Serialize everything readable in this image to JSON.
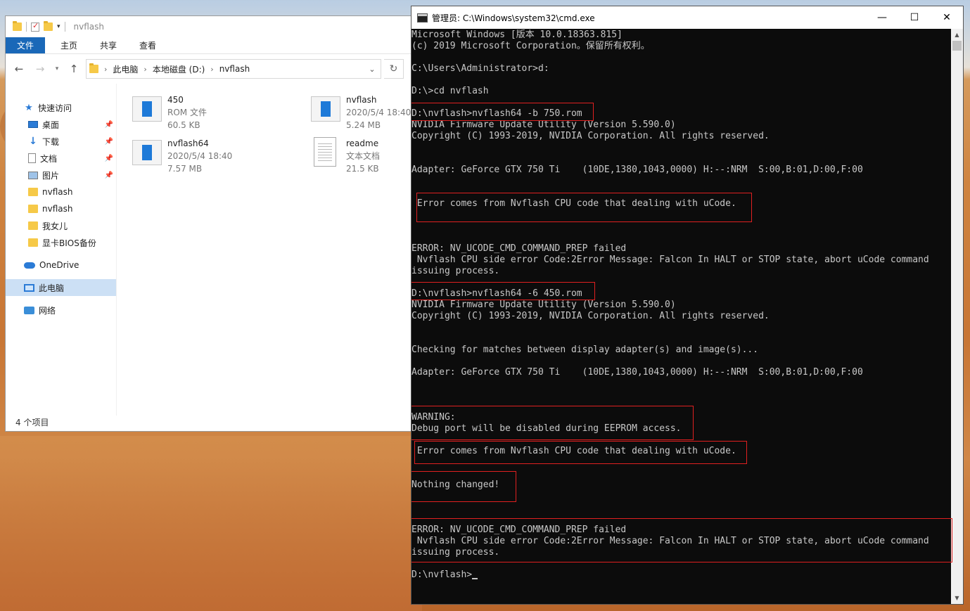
{
  "explorer": {
    "title": "nvflash",
    "ribbon_tabs": [
      "文件",
      "主页",
      "共享",
      "查看"
    ],
    "address": {
      "segments": [
        "此电脑",
        "本地磁盘 (D:)",
        "nvflash"
      ]
    },
    "nav": [
      {
        "label": "快速访问",
        "icon": "star-icon"
      },
      {
        "label": "桌面",
        "icon": "desktop-icon",
        "pinned": true
      },
      {
        "label": "下载",
        "icon": "download-icon",
        "pinned": true
      },
      {
        "label": "文档",
        "icon": "document-icon",
        "pinned": true
      },
      {
        "label": "图片",
        "icon": "pictures-icon",
        "pinned": true
      },
      {
        "label": "nvflash",
        "icon": "folder-icon"
      },
      {
        "label": "nvflash",
        "icon": "folder-icon"
      },
      {
        "label": "我女儿",
        "icon": "folder-icon"
      },
      {
        "label": "显卡BIOS备份",
        "icon": "folder-icon"
      },
      {
        "label": "OneDrive",
        "icon": "onedrive-icon"
      },
      {
        "label": "此电脑",
        "icon": "this-pc-icon",
        "selected": true
      },
      {
        "label": "网络",
        "icon": "network-icon"
      }
    ],
    "files": [
      {
        "name": "450",
        "type": "ROM 文件",
        "size": "60.5 KB"
      },
      {
        "name": "nvflash",
        "date": "2020/5/4 18:40",
        "size": "5.24 MB"
      },
      {
        "name": "nvflash64",
        "date": "2020/5/4 18:40",
        "size": "7.57 MB"
      },
      {
        "name": "readme",
        "type": "文本文档",
        "size": "21.5 KB"
      }
    ],
    "status": "4 个项目"
  },
  "cmd": {
    "title": "管理员: C:\\Windows\\system32\\cmd.exe",
    "lines": [
      "Microsoft Windows [版本 10.0.18363.815]",
      "(c) 2019 Microsoft Corporation。保留所有权利。",
      "",
      "C:\\Users\\Administrator>d:",
      "",
      "D:\\>cd nvflash",
      "",
      "D:\\nvflash>nvflash64 -b 750.rom",
      "NVIDIA Firmware Update Utility (Version 5.590.0)",
      "Copyright (C) 1993-2019, NVIDIA Corporation. All rights reserved.",
      "",
      "",
      "Adapter: GeForce GTX 750 Ti    (10DE,1380,1043,0000) H:--:NRM  S:00,B:01,D:00,F:00",
      "",
      "",
      " Error comes from Nvflash CPU code that dealing with uCode.",
      "",
      "",
      "",
      "ERROR: NV_UCODE_CMD_COMMAND_PREP failed",
      " Nvflash CPU side error Code:2Error Message: Falcon In HALT or STOP state, abort uCode command",
      "issuing process.",
      "",
      "D:\\nvflash>nvflash64 -6 450.rom",
      "NVIDIA Firmware Update Utility (Version 5.590.0)",
      "Copyright (C) 1993-2019, NVIDIA Corporation. All rights reserved.",
      "",
      "",
      "Checking for matches between display adapter(s) and image(s)...",
      "",
      "Adapter: GeForce GTX 750 Ti    (10DE,1380,1043,0000) H:--:NRM  S:00,B:01,D:00,F:00",
      "",
      "",
      "",
      "WARNING:",
      "Debug port will be disabled during EEPROM access.",
      "",
      " Error comes from Nvflash CPU code that dealing with uCode.",
      "",
      "",
      "Nothing changed!",
      "",
      "",
      "",
      "ERROR: NV_UCODE_CMD_COMMAND_PREP failed",
      " Nvflash CPU side error Code:2Error Message: Falcon In HALT or STOP state, abort uCode command",
      "issuing process.",
      "",
      "D:\\nvflash>"
    ]
  }
}
